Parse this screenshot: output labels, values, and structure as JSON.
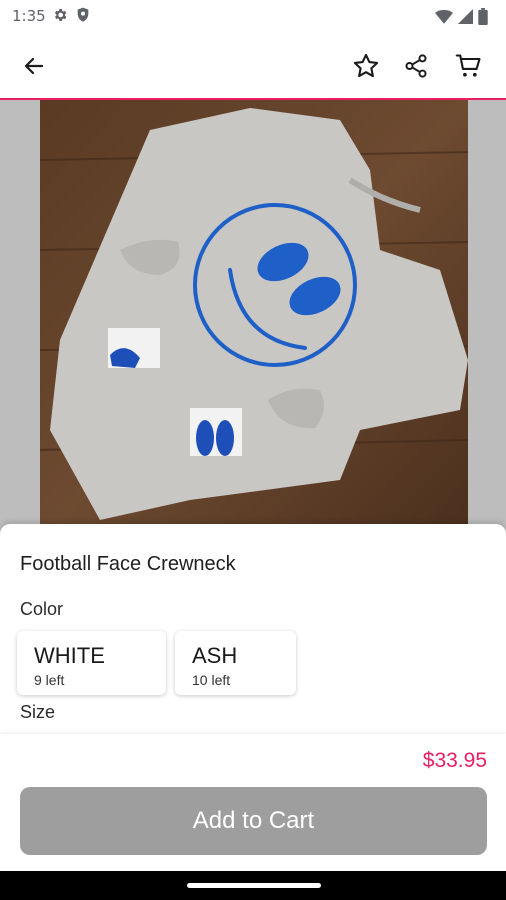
{
  "status_bar": {
    "time": "1:35",
    "icons": [
      "gear-icon",
      "shield-icon",
      "wifi-icon",
      "signal-icon",
      "battery-icon"
    ]
  },
  "app_bar": {
    "icons": [
      "back-arrow-icon",
      "star-icon",
      "share-icon",
      "cart-icon"
    ]
  },
  "product": {
    "title": "Football Face Crewneck",
    "image_alt": "Gray crewneck sweatshirt with blue football smiley face",
    "price": "$33.95"
  },
  "options": {
    "color_label": "Color",
    "colors": [
      {
        "name": "WHITE",
        "stock": "9 left"
      },
      {
        "name": "ASH",
        "stock": "10 left"
      }
    ],
    "size_label": "Size"
  },
  "actions": {
    "add_to_cart": "Add to Cart"
  },
  "colors": {
    "accent": "#e91e63",
    "button_disabled": "#9e9e9e"
  }
}
